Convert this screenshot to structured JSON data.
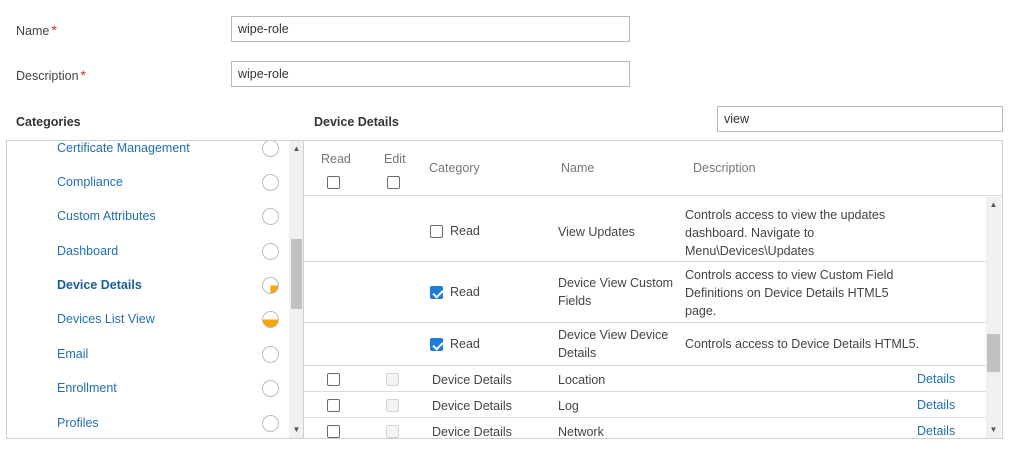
{
  "form": {
    "name_label": "Name",
    "name_value": "wipe-role",
    "description_label": "Description",
    "description_value": "wipe-role",
    "required_mark": "*"
  },
  "categories": {
    "title": "Categories",
    "items": [
      {
        "label": "Certificate Management",
        "state": "empty"
      },
      {
        "label": "Compliance",
        "state": "empty"
      },
      {
        "label": "Custom Attributes",
        "state": "empty"
      },
      {
        "label": "Dashboard",
        "state": "empty"
      },
      {
        "label": "Device Details",
        "state": "quarter",
        "active": true
      },
      {
        "label": "Devices List View",
        "state": "half"
      },
      {
        "label": "Email",
        "state": "empty"
      },
      {
        "label": "Enrollment",
        "state": "empty"
      },
      {
        "label": "Profiles",
        "state": "empty"
      }
    ]
  },
  "details": {
    "title": "Device Details",
    "search_value": "view",
    "columns": {
      "read": "Read",
      "edit": "Edit",
      "category": "Category",
      "name": "Name",
      "description": "Description"
    },
    "expanded_rows": [
      {
        "perm_label": "Read",
        "checked": false,
        "name_lines": [
          "View Updates"
        ],
        "desc_lines": [
          "Controls access to view the updates",
          "dashboard. Navigate to",
          "Menu\\Devices\\Updates"
        ]
      },
      {
        "perm_label": "Read",
        "checked": true,
        "name_lines": [
          "Device View Custom",
          "Fields"
        ],
        "desc_lines": [
          "Controls access to view Custom Field",
          "Definitions on Device Details HTML5",
          "page."
        ]
      },
      {
        "perm_label": "Read",
        "checked": true,
        "name_lines": [
          "Device View Device",
          "Details"
        ],
        "desc_lines": [
          "Controls access to Device Details HTML5."
        ]
      }
    ],
    "rows": [
      {
        "category": "Device Details",
        "name": "Location",
        "link": "Details"
      },
      {
        "category": "Device Details",
        "name": "Log",
        "link": "Details"
      },
      {
        "category": "Device Details",
        "name": "Network",
        "link": "Details"
      }
    ]
  },
  "colors": {
    "link": "#1f6fb2",
    "required": "#d9342b",
    "partial": "#f5a800",
    "checkbox": "#1f7bd6"
  }
}
